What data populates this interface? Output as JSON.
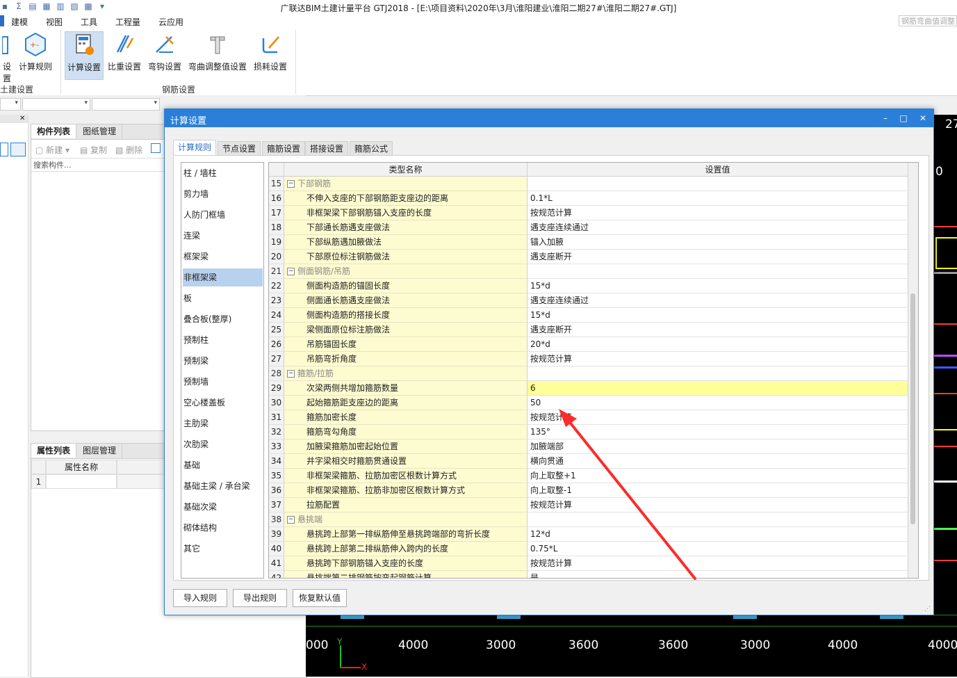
{
  "window": {
    "title": "广联达BIM土建计量平台 GTJ2018 - [E:\\项目资料\\2020年\\3月\\淮阳建业\\淮阳二期27#\\淮阳二期27#.GTJ]",
    "search_placeholder": "钢筋弯曲值调整"
  },
  "menu": {
    "items": [
      "建模",
      "视图",
      "工具",
      "工程量",
      "云应用"
    ]
  },
  "ribbon": {
    "buttons": [
      "设置",
      "计算规则",
      "计算设置",
      "比重设置",
      "弯钩设置",
      "弯曲调整值设置",
      "损耗设置"
    ],
    "groups": [
      "土建设置",
      "钢筋设置"
    ]
  },
  "component_panel": {
    "tabs": [
      "构件列表",
      "图纸管理"
    ],
    "toolbar": [
      "新建",
      "复制",
      "删除"
    ],
    "search_placeholder": "搜索构件..."
  },
  "property_panel": {
    "tabs": [
      "属性列表",
      "图层管理"
    ],
    "column": "属性名称",
    "row_number": "1"
  },
  "cad": {
    "dimensions": [
      "000",
      "4000",
      "3000",
      "3600",
      "3600",
      "3000",
      "4000",
      "4000"
    ],
    "right_labels": [
      "27",
      "0"
    ],
    "axis_y": "Y",
    "axis_x": "X"
  },
  "dialog": {
    "title": "计算设置",
    "tabs": [
      "计算规则",
      "节点设置",
      "箍筋设置",
      "搭接设置",
      "箍筋公式"
    ],
    "categories": [
      "柱 / 墙柱",
      "剪力墙",
      "人防门框墙",
      "连梁",
      "框架梁",
      "非框架梁",
      "板",
      "叠合板(整厚)",
      "预制柱",
      "预制梁",
      "预制墙",
      "空心楼盖板",
      "主肋梁",
      "次肋梁",
      "基础",
      "基础主梁 / 承台梁",
      "基础次梁",
      "砌体结构",
      "其它"
    ],
    "columns": [
      "类型名称",
      "设置值"
    ],
    "rows": [
      {
        "n": "15",
        "name": "下部钢筋",
        "value": "",
        "group": true
      },
      {
        "n": "16",
        "name": "不伸入支座的下部钢筋距支座边的距离",
        "value": "0.1*L"
      },
      {
        "n": "17",
        "name": "非框架梁下部钢筋锚入支座的长度",
        "value": "按规范计算"
      },
      {
        "n": "18",
        "name": "下部通长筋遇支座做法",
        "value": "遇支座连续通过"
      },
      {
        "n": "19",
        "name": "下部纵筋遇加腋做法",
        "value": "锚入加腋"
      },
      {
        "n": "20",
        "name": "下部原位标注钢筋做法",
        "value": "遇支座断开"
      },
      {
        "n": "21",
        "name": "侧面钢筋/吊筋",
        "value": "",
        "group": true
      },
      {
        "n": "22",
        "name": "侧面构造筋的锚固长度",
        "value": "15*d"
      },
      {
        "n": "23",
        "name": "侧面通长筋遇支座做法",
        "value": "遇支座连续通过"
      },
      {
        "n": "24",
        "name": "侧面构造筋的搭接长度",
        "value": "15*d"
      },
      {
        "n": "25",
        "name": "梁侧面原位标注筋做法",
        "value": "遇支座断开"
      },
      {
        "n": "26",
        "name": "吊筋锚固长度",
        "value": "20*d"
      },
      {
        "n": "27",
        "name": "吊筋弯折角度",
        "value": "按规范计算"
      },
      {
        "n": "28",
        "name": "箍筋/拉筋",
        "value": "",
        "group": true
      },
      {
        "n": "29",
        "name": "次梁两侧共增加箍筋数量",
        "value": "6",
        "highlight": true
      },
      {
        "n": "30",
        "name": "起始箍筋距支座边的距离",
        "value": "50"
      },
      {
        "n": "31",
        "name": "箍筋加密长度",
        "value": "按规范计算"
      },
      {
        "n": "32",
        "name": "箍筋弯勾角度",
        "value": "135°"
      },
      {
        "n": "33",
        "name": "加腋梁箍筋加密起始位置",
        "value": "加腋端部"
      },
      {
        "n": "34",
        "name": "井字梁相交时箍筋贯通设置",
        "value": "横向贯通"
      },
      {
        "n": "35",
        "name": "非框架梁箍筋、拉筋加密区根数计算方式",
        "value": "向上取整+1"
      },
      {
        "n": "36",
        "name": "非框架梁箍筋、拉筋非加密区根数计算方式",
        "value": "向上取整-1"
      },
      {
        "n": "37",
        "name": "拉筋配置",
        "value": "按规范计算"
      },
      {
        "n": "38",
        "name": "悬挑端",
        "value": "",
        "group": true
      },
      {
        "n": "39",
        "name": "悬挑跨上部第一排纵筋伸至悬挑跨端部的弯折长度",
        "value": "12*d"
      },
      {
        "n": "40",
        "name": "悬挑跨上部第二排纵筋伸入跨内的长度",
        "value": "0.75*L"
      },
      {
        "n": "41",
        "name": "悬挑跨下部钢筋锚入支座的长度",
        "value": "按规范计算"
      },
      {
        "n": "42",
        "name": "悬挑端第二排钢筋按弯起钢筋计算",
        "value": "是"
      }
    ],
    "buttons": [
      "导入规则",
      "导出规则",
      "恢复默认值"
    ]
  }
}
